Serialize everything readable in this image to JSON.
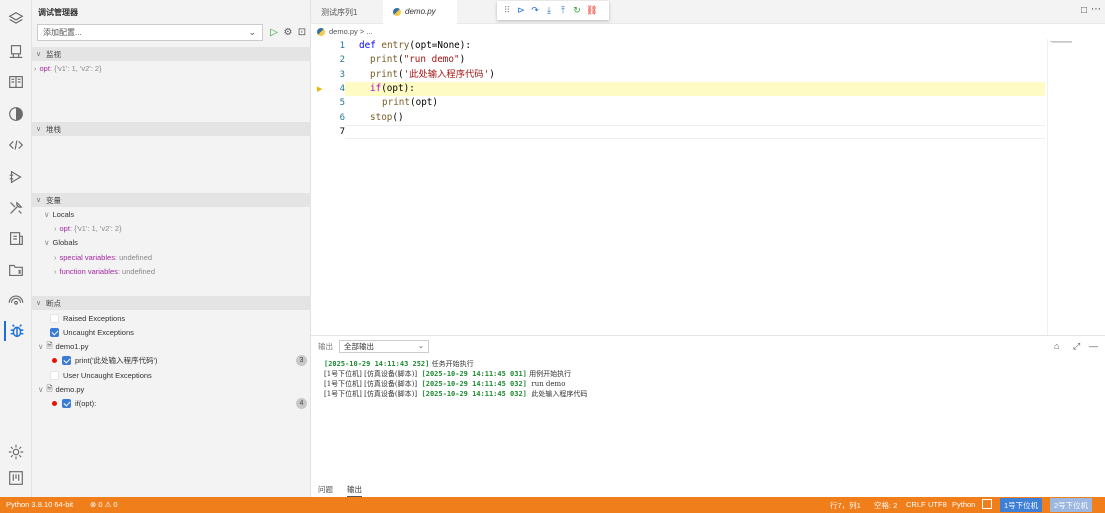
{
  "sidebar": {
    "title": "调试管理器",
    "config_placeholder": "添加配置...",
    "watch": {
      "header": "监视",
      "item_key": "opt",
      "item_value": "{'v1': 1, 'v2': 2}"
    },
    "stack": {
      "header": "堆栈"
    },
    "variables": {
      "header": "变量",
      "locals_label": "Locals",
      "local_key": "opt",
      "local_value": "{'v1': 1, 'v2': 2}",
      "globals_label": "Globals",
      "special_key": "special variables",
      "special_value": "undefined",
      "function_key": "function variables",
      "function_value": "undefined"
    },
    "breakpoints": {
      "header": "断点",
      "raised": "Raised Exceptions",
      "uncaught": "Uncaught Exceptions",
      "file1": "demo1.py",
      "bp1_label": "print('此处输入程序代码')",
      "bp1_line": "3",
      "user_uncaught": "User Uncaught Exceptions",
      "file2": "demo.py",
      "bp2_label": "if(opt):",
      "bp2_line": "4"
    }
  },
  "tabs": {
    "tab1": "测试序列1",
    "tab2": "demo.py"
  },
  "breadcrumb": {
    "file": "demo.py",
    "rest": "> ..."
  },
  "editor": {
    "line_numbers": [
      "1",
      "2",
      "3",
      "4",
      "5",
      "6",
      "7"
    ],
    "l1_kw": "def",
    "l1_fn": "entry",
    "l1_rest": "(opt=None):",
    "l2_fn": "print",
    "l2_open": "(",
    "l2_str": "\"run demo\"",
    "l2_close": ")",
    "l3_fn": "print",
    "l3_open": "(",
    "l3_str": "'此处输入程序代码'",
    "l3_close": ")",
    "l4_kw": "if",
    "l4_rest": "(opt):",
    "l5_fn": "print",
    "l5_rest": "(opt)",
    "l6_fn": "stop",
    "l6_rest": "()"
  },
  "output_panel": {
    "label": "输出",
    "select_value": "全部输出",
    "logs": [
      {
        "ts": "[2025-10-29 14:11:43 252]",
        "msg": "任务开始执行"
      },
      {
        "pre": "[1号下位机] [仿真设备(脚本)]",
        "ts": "[2025-10-29 14:11:45 031]",
        "msg": "用例开始执行"
      },
      {
        "pre": "[1号下位机] [仿真设备(脚本)]",
        "ts": "[2025-10-29 14:11:45 032]",
        "msg": "run demo"
      },
      {
        "pre": "[1号下位机] [仿真设备(脚本)]",
        "ts": "[2025-10-29 14:11:45 032]",
        "msg": "此处输入程序代码"
      }
    ],
    "tab_problems": "问题",
    "tab_output": "输出"
  },
  "statusbar": {
    "python": "Python 3.8.10 64-bit",
    "problems": "⊗ 0 ⚠ 0",
    "position": "行7，列1",
    "spaces": "空格: 2",
    "eol": "CRLF",
    "encoding": "UTF8",
    "language": "Python",
    "device1": "1号下位机",
    "device2": "2号下位机"
  },
  "colors": {
    "accent": "#f07e1b",
    "highlight": "#fffbc4",
    "debug_blue": "#1a6fd6"
  }
}
